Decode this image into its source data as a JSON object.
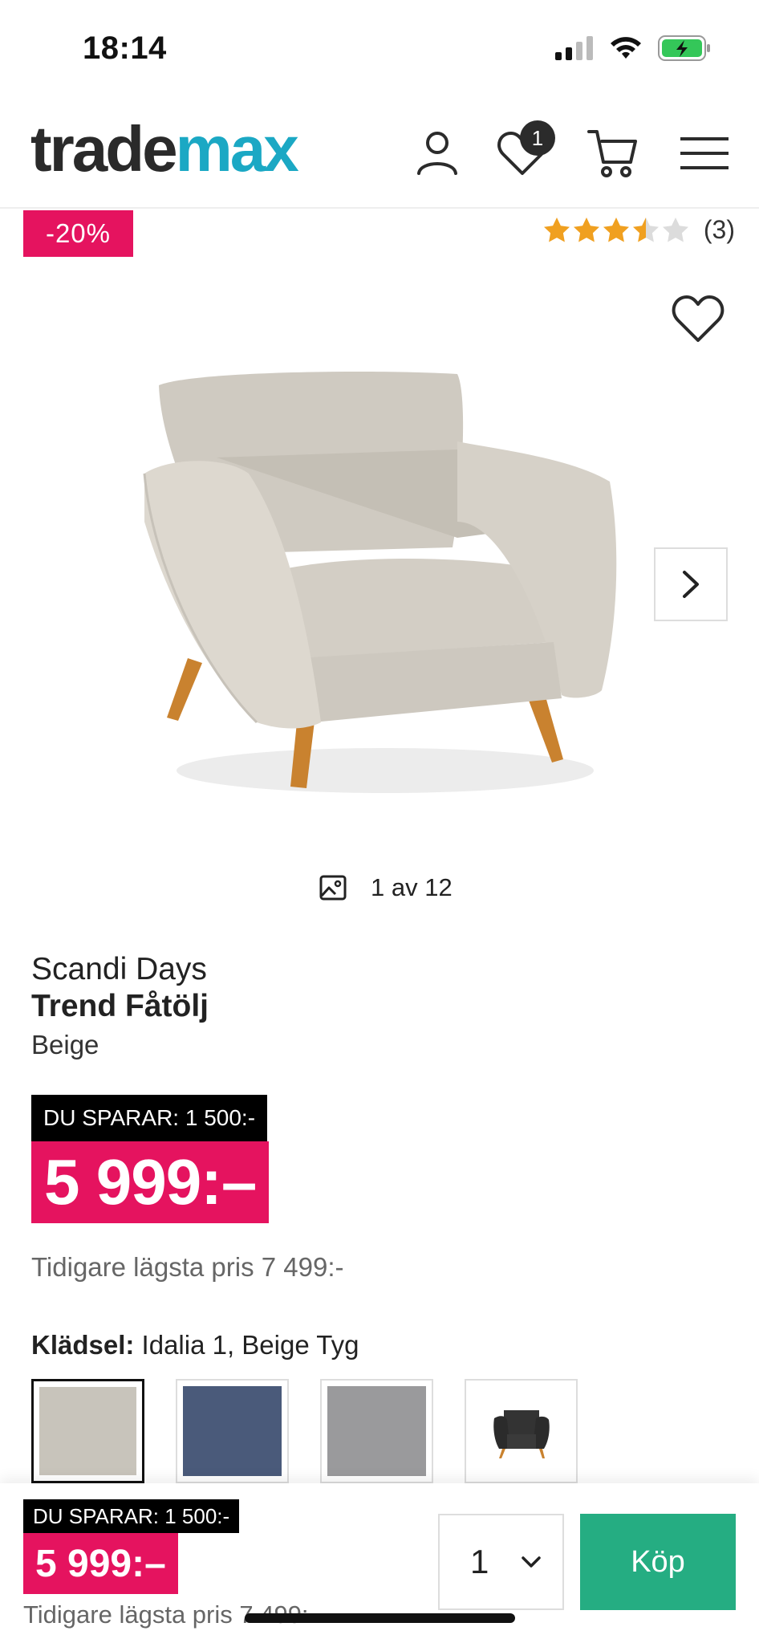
{
  "status_bar": {
    "time": "18:14"
  },
  "header": {
    "logo_part1": "trade",
    "logo_part2": "max",
    "wishlist_count": "1",
    "icons": [
      "user-icon",
      "heart-icon",
      "cart-icon",
      "menu-icon"
    ]
  },
  "product": {
    "discount_badge": "-20%",
    "rating_value": 3.5,
    "rating_count": "(3)",
    "image_counter": "1 av 12",
    "brand": "Scandi Days",
    "name": "Trend Fåtölj",
    "color": "Beige",
    "save_label": "DU SPARAR: 1 500:-",
    "price": "5 999:–",
    "previous_price": "Tidigare lägsta pris 7 499:-",
    "upholstery_label": "Klädsel:",
    "upholstery_value": "Idalia 1, Beige Tyg"
  },
  "swatches": [
    {
      "name": "beige",
      "color": "#c8c4bb",
      "selected": true
    },
    {
      "name": "blue",
      "color": "#4a5a7a",
      "selected": false
    },
    {
      "name": "grey",
      "color": "#9a9a9c",
      "selected": false
    },
    {
      "name": "black-chair",
      "color": "#2b2b2b",
      "selected": false
    }
  ],
  "sticky_bar": {
    "save_label": "DU SPARAR: 1 500:-",
    "price": "5 999:–",
    "previous_price": "Tidigare lägsta pris 7 499:-",
    "quantity": "1",
    "buy_label": "Köp"
  },
  "colors": {
    "accent_pink": "#e5135f",
    "buy_green": "#25ad82",
    "logo_teal": "#1ba8c4",
    "star_orange": "#f0a020"
  }
}
